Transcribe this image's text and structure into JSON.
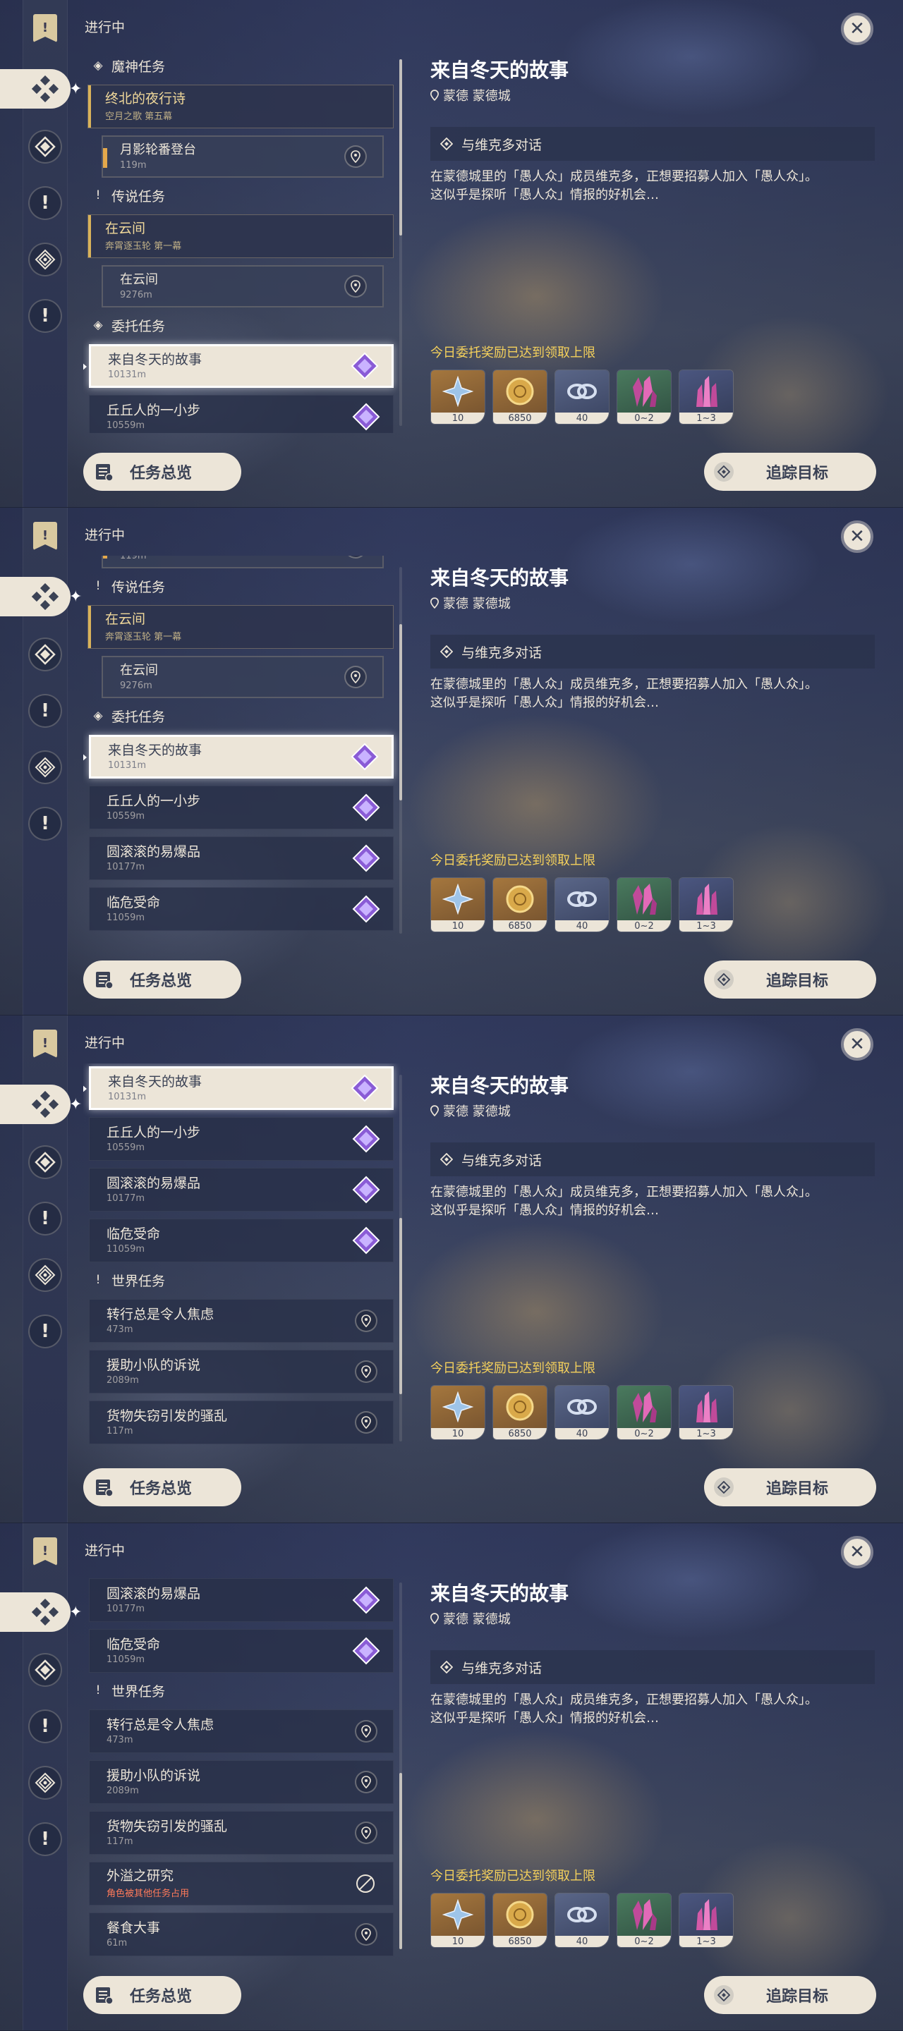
{
  "header": {
    "status_label": "进行中",
    "close_glyph": "✕"
  },
  "categories": {
    "archon": "魔神任务",
    "legend": "传说任务",
    "commission": "委托任务",
    "world": "世界任务"
  },
  "quests": {
    "archon_main": {
      "title": "终北的夜行诗",
      "subtitle": "空月之歌 第五幕"
    },
    "archon_sub": {
      "title": "月影轮番登台",
      "distance": "119m"
    },
    "legend_main": {
      "title": "在云间",
      "subtitle": "奔霄逐玉轮 第一幕"
    },
    "legend_sub": {
      "title": "在云间",
      "distance": "9276m"
    },
    "commission_1": {
      "title": "来自冬天的故事",
      "distance": "10131m"
    },
    "commission_2": {
      "title": "丘丘人的一小步",
      "distance": "10559m"
    },
    "commission_3": {
      "title": "圆滚滚的易爆品",
      "distance": "10177m"
    },
    "commission_4": {
      "title": "临危受命",
      "distance": "11059m"
    },
    "world_1": {
      "title": "转行总是令人焦虑",
      "distance": "473m"
    },
    "world_2": {
      "title": "援助小队的诉说",
      "distance": "2089m"
    },
    "world_3": {
      "title": "货物失窃引发的骚乱",
      "distance": "117m"
    },
    "world_4": {
      "title": "外溢之研究",
      "note": "角色被其他任务占用"
    },
    "world_5": {
      "title": "餐食大事",
      "distance": "61m"
    }
  },
  "detail": {
    "title": "来自冬天的故事",
    "location": "蒙德 蒙德城",
    "objective": "与维克多对话",
    "description_line1": "在蒙德城里的「愚人众」成员维克多，正想要招募人加入「愚人众」。",
    "description_line2": "这似乎是探听「愚人众」情报的好机会…",
    "reward_notice": "今日委托奖励已达到领取上限",
    "rewards": [
      {
        "icon": "adventure-exp-icon",
        "count": "10"
      },
      {
        "icon": "mora-icon",
        "count": "6850"
      },
      {
        "icon": "friendship-exp-icon",
        "count": "40"
      },
      {
        "icon": "crystal-chunk-icon",
        "count": "0~2"
      },
      {
        "icon": "crystal-cluster-icon",
        "count": "1~3"
      }
    ]
  },
  "footer": {
    "overview_label": "任务总览",
    "track_label": "追踪目标"
  },
  "colors": {
    "cream": "#ece5d8",
    "dark_text": "#3b4255",
    "notice_yellow": "#f5d15c",
    "archon_gold": "#f0d89a",
    "commission_purple": "#8a5cd6",
    "warning_red": "#ff7a5a"
  },
  "list_scroll_fraction": [
    0,
    0.3,
    0.75,
    1
  ]
}
